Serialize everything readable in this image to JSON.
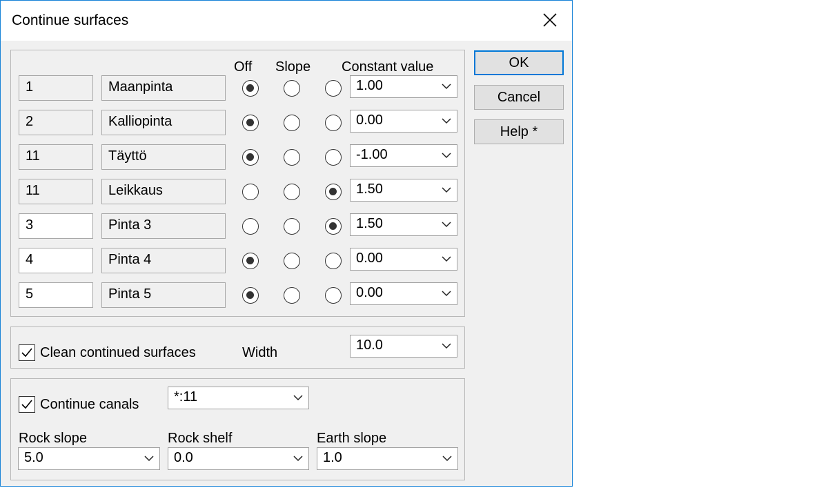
{
  "window": {
    "title": "Continue surfaces"
  },
  "surfaces": {
    "headers": {
      "off": "Off",
      "slope": "Slope",
      "constant": "Constant value"
    },
    "rows": [
      {
        "id": "1",
        "name": "Maanpinta",
        "editable": false,
        "mode": "off",
        "constant": "1.00"
      },
      {
        "id": "2",
        "name": "Kalliopinta",
        "editable": false,
        "mode": "off",
        "constant": "0.00"
      },
      {
        "id": "11",
        "name": "Täyttö",
        "editable": false,
        "mode": "off",
        "constant": "-1.00"
      },
      {
        "id": "11",
        "name": "Leikkaus",
        "editable": false,
        "mode": "constant",
        "constant": "1.50"
      },
      {
        "id": "3",
        "name": "Pinta 3",
        "editable": true,
        "mode": "constant",
        "constant": "1.50"
      },
      {
        "id": "4",
        "name": "Pinta 4",
        "editable": true,
        "mode": "off",
        "constant": "0.00"
      },
      {
        "id": "5",
        "name": "Pinta 5",
        "editable": true,
        "mode": "off",
        "constant": "0.00"
      }
    ]
  },
  "clean": {
    "label": "Clean continued surfaces",
    "checked": true,
    "width_label": "Width",
    "width_value": "10.0"
  },
  "canals": {
    "label": "Continue canals",
    "checked": true,
    "filter_value": "*:11",
    "rock_slope_label": "Rock slope",
    "rock_slope_value": "5.0",
    "rock_shelf_label": "Rock shelf",
    "rock_shelf_value": "0.0",
    "earth_slope_label": "Earth slope",
    "earth_slope_value": "1.0"
  },
  "buttons": {
    "ok": "OK",
    "cancel": "Cancel",
    "help": "Help *"
  }
}
